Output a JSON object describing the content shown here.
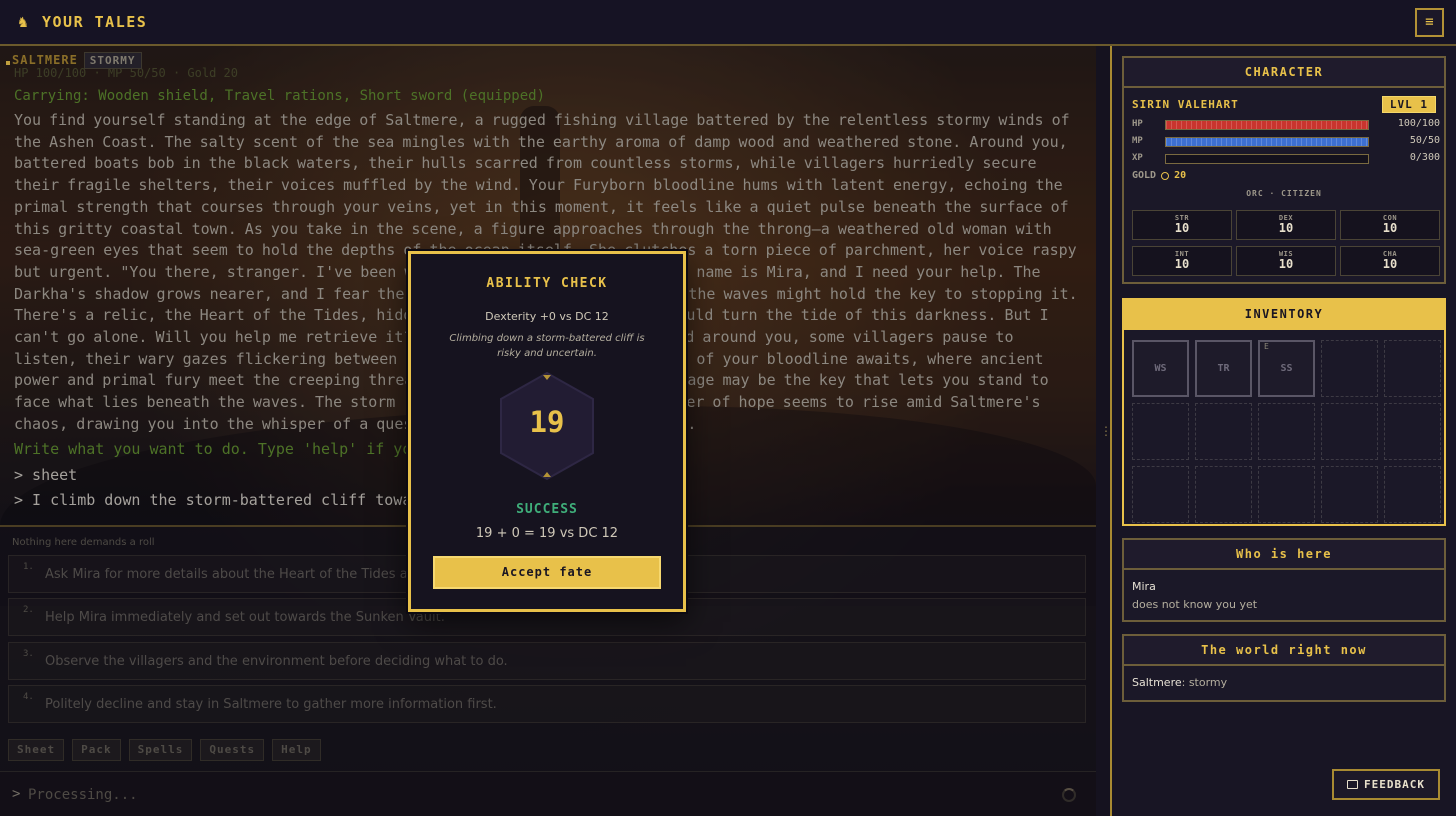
{
  "header": {
    "title": "YOUR TALES",
    "logo_icon": "warrior-icon",
    "menu_icon": "hamburger-icon"
  },
  "story": {
    "location": "SALTMERE",
    "weather": "STORMY",
    "stats_line": "HP 100/100 · MP 50/50 · Gold 20",
    "carrying": "Carrying: Wooden shield, Travel rations, Short sword (equipped)",
    "narrative": "You find yourself standing at the edge of Saltmere, a rugged fishing village battered by the relentless stormy winds of the Ashen Coast. The salty scent of the sea mingles with the earthy aroma of damp wood and weathered stone. Around you, battered boats bob in the black waters, their hulls scarred from countless storms, while villagers hurriedly secure their fragile shelters, their voices muffled by the wind. Your Furyborn bloodline hums with latent energy, echoing the primal strength that courses through your veins, yet in this moment, it feels like a quiet pulse beneath the surface of this gritty coastal town. As you take in the scene, a figure approaches through the throng—a weathered old woman with sea-green eyes that seem to hold the depths of the ocean itself. She clutches a torn piece of parchment, her voice raspy but urgent. \"You there, stranger. I've been waiting for someone like you. My name is Mira, and I need your help. The Darkha's shadow grows nearer, and I fear the ancient secrets buried beneath the waves might hold the key to stopping it. There's a relic, the Heart of the Tides, hidden in the Sunken Vault, that could turn the tide of this darkness. But I can't go alone. Will you help me retrieve it?\" Her words hang in the air, and around you, some villagers pause to listen, their wary gazes flickering between you and her. The first true test of your bloodline awaits, where ancient power and primal fury meet the creeping threat of the Darkha, and your heritage may be the key that lets you stand to face what lies beneath the waves. The storm rages on behind her, but a flicker of hope seems to rise amid Saltmere's chaos, drawing you into the whisper of a quest that could shape your destiny.",
    "prompt_hint": "Write what you want to do. Type 'help' if you need it.",
    "history": [
      "> sheet",
      "> I climb down the storm-battered cliff towards the docks"
    ]
  },
  "choices": {
    "header": "Nothing here demands a roll",
    "items": [
      {
        "num": "1.",
        "text": "Ask Mira for more details about the Heart of the Tides and the Darkha."
      },
      {
        "num": "2.",
        "text": "Help Mira immediately and set out towards the Sunken Vault."
      },
      {
        "num": "3.",
        "text": "Observe the villagers and the environment before deciding what to do."
      },
      {
        "num": "4.",
        "text": "Politely decline and stay in Saltmere to gather more information first."
      }
    ]
  },
  "quick_actions": [
    "Sheet",
    "Pack",
    "Spells",
    "Quests",
    "Help"
  ],
  "input": {
    "caret": ">",
    "placeholder": "Processing..."
  },
  "character": {
    "panel_title": "CHARACTER",
    "name": "SIRIN VALEHART",
    "level": "LVL 1",
    "hp": {
      "label": "HP",
      "value": "100/100",
      "fraction": 1.0
    },
    "mp": {
      "label": "MP",
      "value": "50/50",
      "fraction": 1.0
    },
    "xp": {
      "label": "XP",
      "value": "0/300",
      "fraction": 0.0
    },
    "gold_label": "GOLD",
    "gold": "20",
    "race_class": "ORC · CITIZEN",
    "abilities": [
      {
        "key": "STR",
        "value": "10"
      },
      {
        "key": "DEX",
        "value": "10"
      },
      {
        "key": "CON",
        "value": "10"
      },
      {
        "key": "INT",
        "value": "10"
      },
      {
        "key": "WIS",
        "value": "10"
      },
      {
        "key": "CHA",
        "value": "10"
      }
    ]
  },
  "inventory": {
    "panel_title": "INVENTORY",
    "slots": [
      {
        "code": "WS",
        "equipped": ""
      },
      {
        "code": "TR",
        "equipped": ""
      },
      {
        "code": "SS",
        "equipped": "E"
      },
      {
        "code": "",
        "equipped": ""
      },
      {
        "code": "",
        "equipped": ""
      },
      {
        "code": "",
        "equipped": ""
      },
      {
        "code": "",
        "equipped": ""
      },
      {
        "code": "",
        "equipped": ""
      },
      {
        "code": "",
        "equipped": ""
      },
      {
        "code": "",
        "equipped": ""
      },
      {
        "code": "",
        "equipped": ""
      },
      {
        "code": "",
        "equipped": ""
      },
      {
        "code": "",
        "equipped": ""
      },
      {
        "code": "",
        "equipped": ""
      },
      {
        "code": "",
        "equipped": ""
      }
    ]
  },
  "who_is_here": {
    "panel_title": "Who is here",
    "npc_name": "Mira",
    "npc_status": "does not know you yet"
  },
  "world": {
    "panel_title": "The world right now",
    "place": "Saltmere",
    "state": ": stormy"
  },
  "feedback": {
    "label": "FEEDBACK",
    "icon": "chat-icon"
  },
  "ability_check": {
    "title": "ABILITY CHECK",
    "subtitle": "Dexterity +0 vs DC 12",
    "description": "Climbing down a storm-battered cliff is risky and uncertain.",
    "roll": "19",
    "result": "SUCCESS",
    "math": "19 + 0 = 19 vs DC 12",
    "accept_label": "Accept fate"
  },
  "colors": {
    "accent": "#e8c14a",
    "success": "#3fae7a",
    "hp": "#c9352e",
    "mp": "#3d6fd0"
  }
}
